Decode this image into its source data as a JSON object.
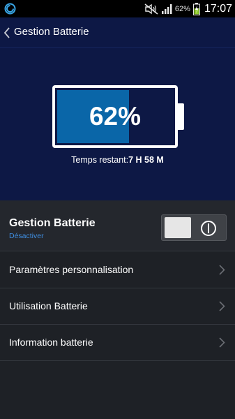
{
  "status_bar": {
    "battery_percent": "62%",
    "time": "17:07",
    "icons": [
      "app-notification-icon",
      "mute-icon",
      "signal-icon",
      "battery-charging-icon"
    ]
  },
  "header": {
    "title": "Gestion Batterie",
    "back_icon": "back-chevron-icon"
  },
  "battery": {
    "level_fraction": 0.62,
    "percent_label": "62%",
    "remaining_label": "Temps restant:",
    "remaining_value": "7 H 58 M",
    "fill_color": "#0a66a8"
  },
  "toggle_row": {
    "title": "Gestion Batterie",
    "subtitle": "Désactiver",
    "state": "off"
  },
  "menu": {
    "items": [
      {
        "label": "Paramètres personnalisation"
      },
      {
        "label": "Utilisation Batterie"
      },
      {
        "label": "Information batterie"
      }
    ]
  },
  "colors": {
    "header_bg": "#0d1845",
    "list_bg": "#1e2126",
    "accent_blue": "#3f8ee0"
  }
}
